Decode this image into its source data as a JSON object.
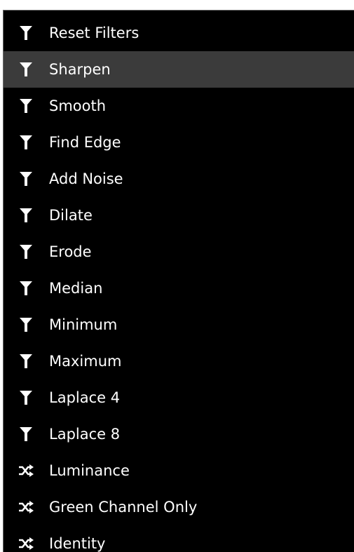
{
  "menu": {
    "highlight_color": "#3b3b3b",
    "background_color": "#000000",
    "text_color": "#ffffff",
    "items": [
      {
        "label": "Reset Filters",
        "icon": "filter-icon",
        "highlighted": false
      },
      {
        "label": "Sharpen",
        "icon": "filter-icon",
        "highlighted": true
      },
      {
        "label": "Smooth",
        "icon": "filter-icon",
        "highlighted": false
      },
      {
        "label": "Find Edge",
        "icon": "filter-icon",
        "highlighted": false
      },
      {
        "label": "Add Noise",
        "icon": "filter-icon",
        "highlighted": false
      },
      {
        "label": "Dilate",
        "icon": "filter-icon",
        "highlighted": false
      },
      {
        "label": "Erode",
        "icon": "filter-icon",
        "highlighted": false
      },
      {
        "label": "Median",
        "icon": "filter-icon",
        "highlighted": false
      },
      {
        "label": "Minimum",
        "icon": "filter-icon",
        "highlighted": false
      },
      {
        "label": "Maximum",
        "icon": "filter-icon",
        "highlighted": false
      },
      {
        "label": "Laplace 4",
        "icon": "filter-icon",
        "highlighted": false
      },
      {
        "label": "Laplace 8",
        "icon": "filter-icon",
        "highlighted": false
      },
      {
        "label": "Luminance",
        "icon": "shuffle-icon",
        "highlighted": false
      },
      {
        "label": "Green Channel Only",
        "icon": "shuffle-icon",
        "highlighted": false
      },
      {
        "label": "Identity",
        "icon": "shuffle-icon",
        "highlighted": false
      }
    ]
  }
}
